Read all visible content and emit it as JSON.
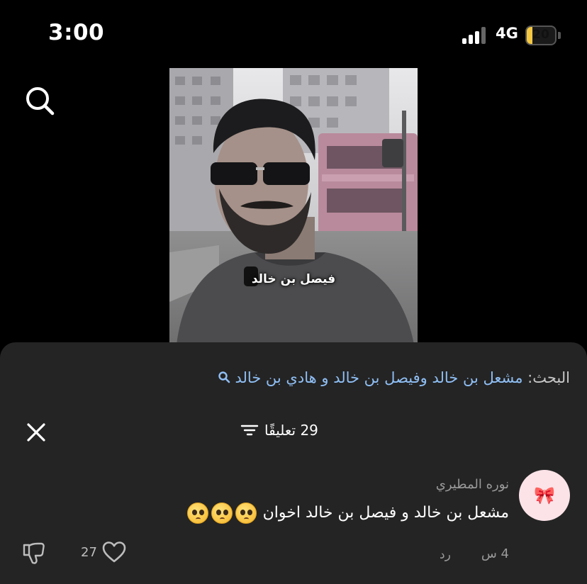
{
  "status_bar": {
    "time": "3:00",
    "network": "4G",
    "battery": "20",
    "battery_level": 0.2
  },
  "video": {
    "caption": "فيصل بن خالد"
  },
  "comments_sheet": {
    "related_search_label": "البحث:",
    "related_search_query": "مشعل بن خالد وفيصل بن خالد و هادي بن خالد",
    "comment_count": "29 تعليقًا",
    "comments": [
      {
        "author": "نوره المطيري",
        "text": "مشعل بن خالد و فيصل بن خالد اخوان",
        "emoji_count": 3,
        "time": "4 س",
        "reply_label": "رد",
        "likes": "27",
        "avatar_glyph": "🎀"
      }
    ]
  },
  "colors": {
    "sheet_background": "#242424",
    "link": "#8fbff5",
    "muted": "#9a9a9a"
  }
}
